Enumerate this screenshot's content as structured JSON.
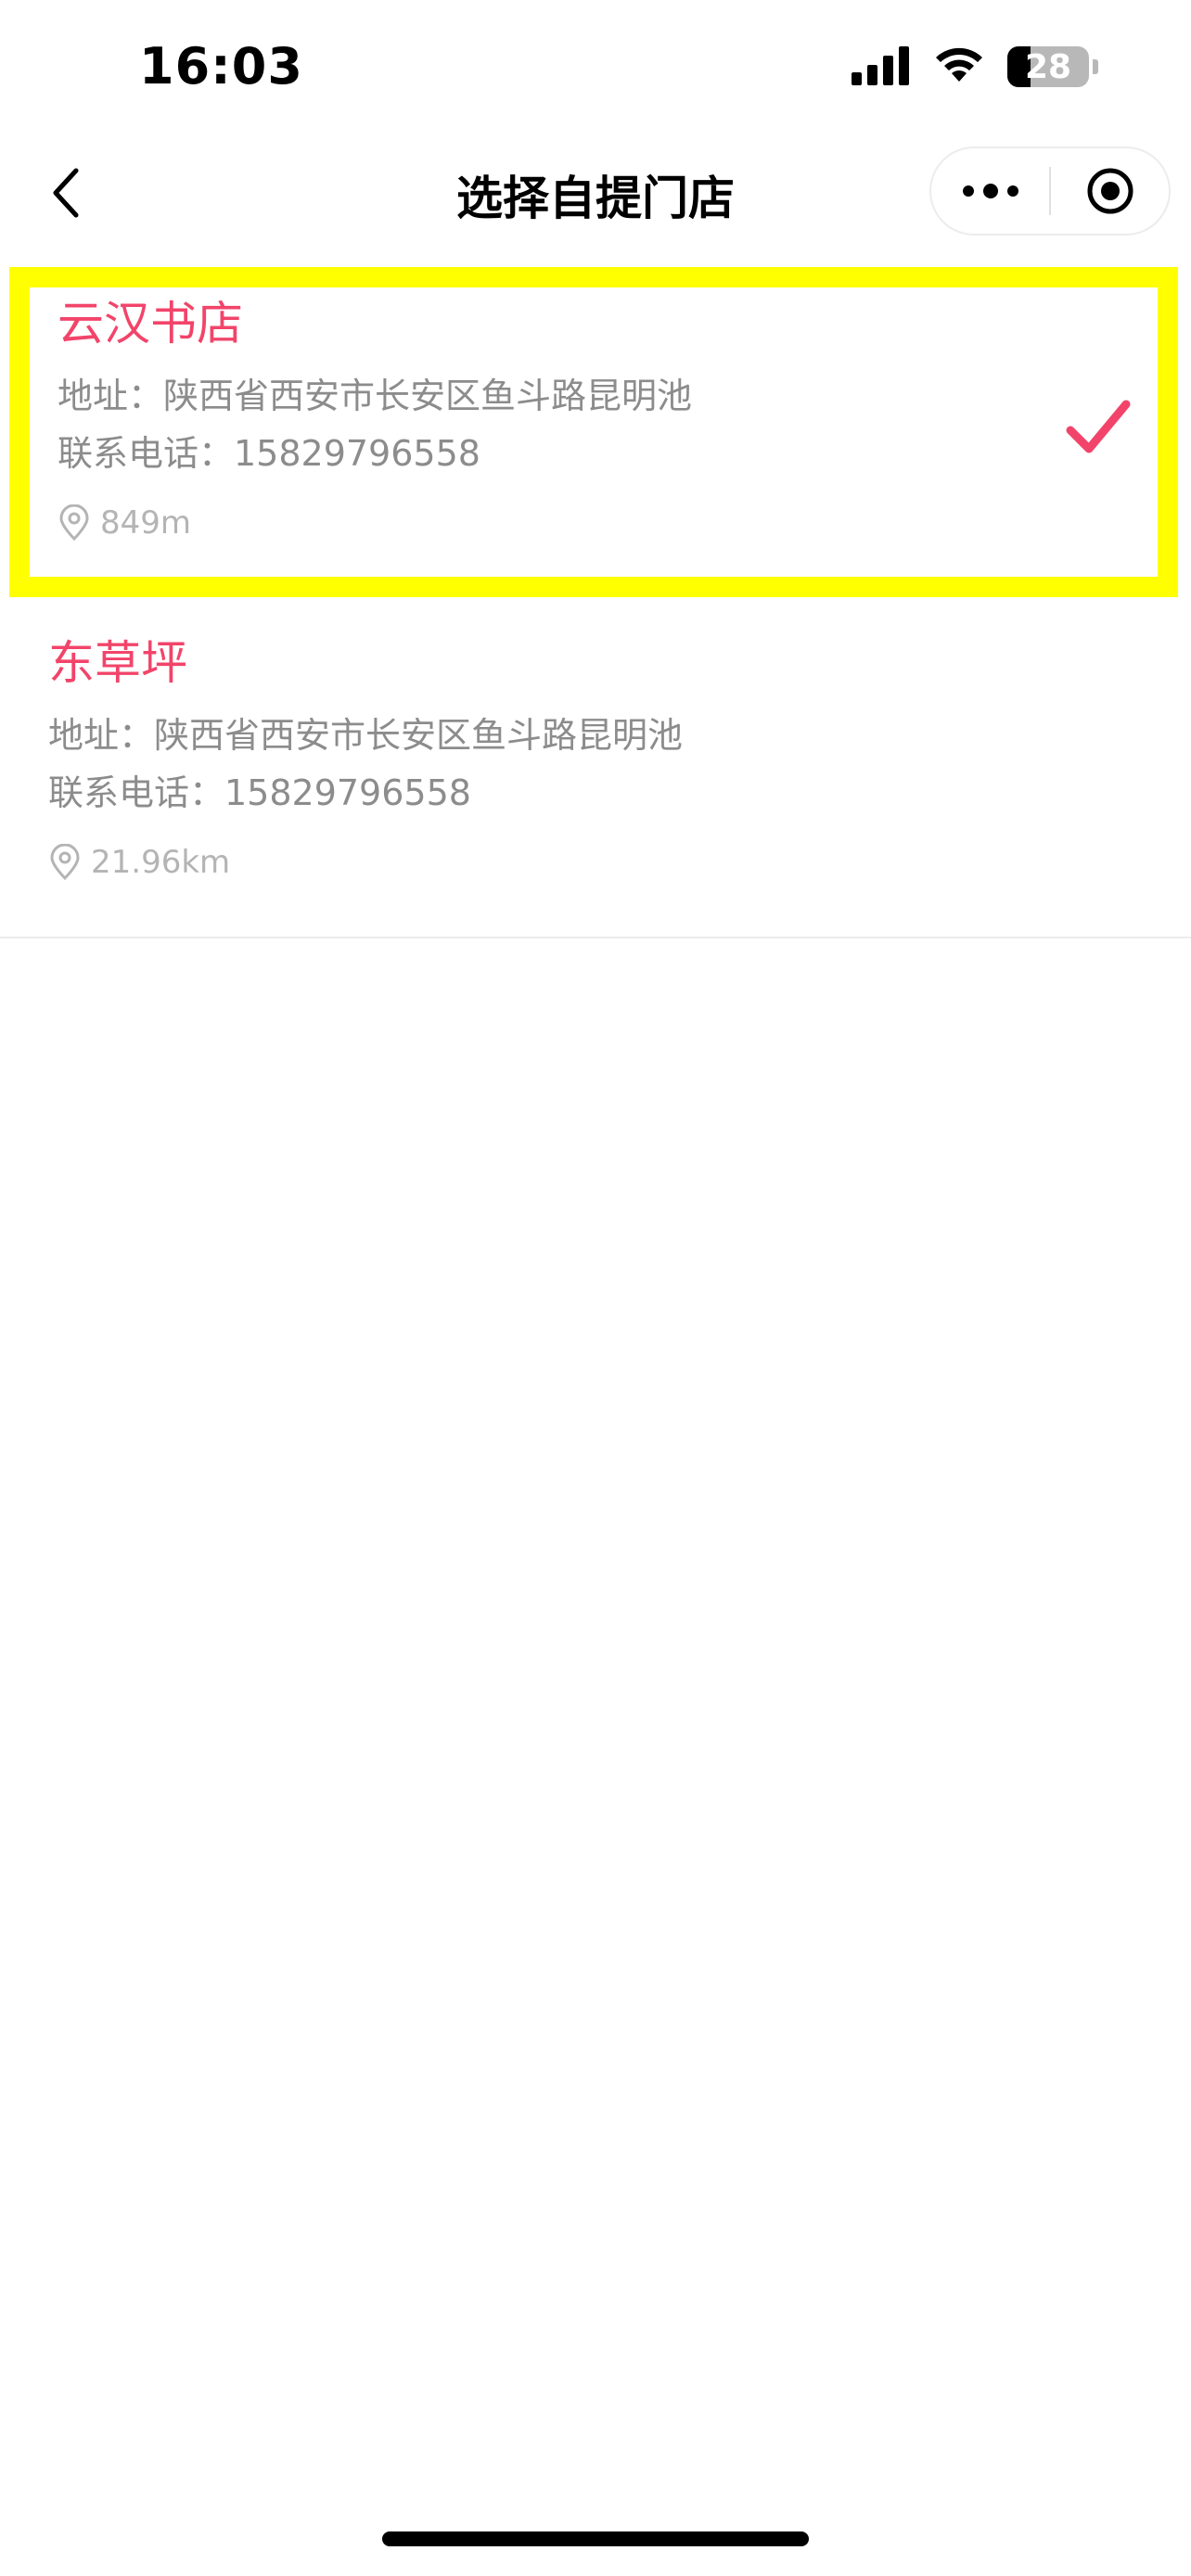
{
  "status_bar": {
    "time": "16:03",
    "battery": "28",
    "battery_level_percent": 28
  },
  "nav": {
    "title": "选择自提门店"
  },
  "stores": [
    {
      "name": "云汉书店",
      "address": "地址：陕西省西安市长安区鱼斗路昆明池",
      "phone": "联系电话：15829796558",
      "distance": "849m",
      "selected": true
    },
    {
      "name": "东草坪",
      "address": "地址：陕西省西安市长安区鱼斗路昆明池",
      "phone": "联系电话：15829796558",
      "distance": "21.96km",
      "selected": false
    }
  ],
  "colors": {
    "accent": "#f2446a",
    "highlight": "#ffff00",
    "secondary_text": "#8c8c8c"
  }
}
